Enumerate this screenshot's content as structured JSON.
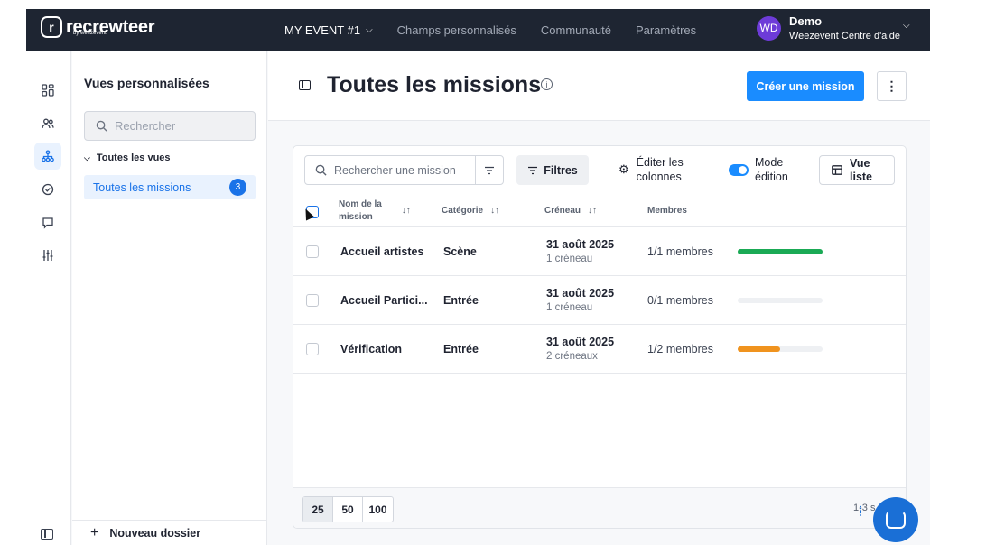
{
  "header": {
    "brand": "recrewteer",
    "brand_sub": "by weezevent",
    "nav": [
      {
        "label": "MY EVENT #1"
      },
      {
        "label": "Champs personnalisés"
      },
      {
        "label": "Communauté"
      },
      {
        "label": "Paramètres"
      }
    ],
    "user": {
      "initials": "WD",
      "name": "Demo",
      "org": "Weezevent Centre d'aide"
    }
  },
  "rail": {
    "icons": [
      "dashboard-icon",
      "users-icon",
      "org-chart-icon",
      "check-circle-icon",
      "chat-icon",
      "sliders-icon"
    ]
  },
  "views": {
    "title": "Vues personnalisées",
    "search_placeholder": "Rechercher",
    "group_label": "Toutes les vues",
    "item_label": "Toutes les missions",
    "item_count": "3",
    "new_folder": "Nouveau dossier"
  },
  "main": {
    "title": "Toutes les missions",
    "create_button": "Créer une mission",
    "more": "⋮"
  },
  "toolbar": {
    "search_placeholder": "Rechercher une mission",
    "filters": "Filtres",
    "edit_columns_1": "Éditer les",
    "edit_columns_2": "colonnes",
    "mode_1": "Mode",
    "mode_2": "édition",
    "list_view_1": "Vue",
    "list_view_2": "liste"
  },
  "table": {
    "headers": {
      "name_1": "Nom de la",
      "name_2": "mission",
      "category": "Catégorie",
      "slot": "Créneau",
      "members": "Membres"
    },
    "rows": [
      {
        "name": "Accueil artistes",
        "category": "Scène",
        "date": "31 août 2025",
        "slots": "1 créneau",
        "members": "1/1 membres",
        "fill": 1.0,
        "color": "#1aaa55"
      },
      {
        "name": "Accueil Partici...",
        "category": "Entrée",
        "date": "31 août 2025",
        "slots": "1 créneau",
        "members": "0/1 membres",
        "fill": 0.0,
        "color": "#eef0f3"
      },
      {
        "name": "Vérification",
        "category": "Entrée",
        "date": "31 août 2025",
        "slots": "2 créneaux",
        "members": "1/2 membres",
        "fill": 0.5,
        "color": "#f0931e"
      }
    ]
  },
  "pagination": {
    "sizes": [
      "25",
      "50",
      "100"
    ],
    "range": "1-3 s"
  },
  "colors": {
    "accent": "#1a8cff",
    "topbar": "#1e2532"
  }
}
